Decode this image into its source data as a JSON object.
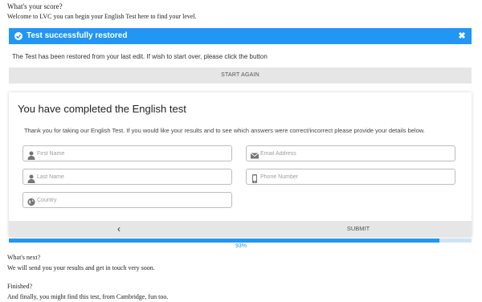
{
  "intro": {
    "question": "What's your score?",
    "text": "Welcome to LVC you can begin your English Test here to find your level."
  },
  "alert": {
    "title": "Test successfully restored",
    "close": "✖",
    "icon": "check-circle-icon",
    "color": "#2196f3",
    "message": "The Test has been restored from your last edit. If wish to start over, please click the button"
  },
  "start_again_label": "START AGAIN",
  "card": {
    "title": "You have completed the English test",
    "description": "Thank you for taking our English Test. If you would like your results and to see which answers were correct/incorrect please provide your details below.",
    "fields": {
      "first_name": {
        "placeholder": "First Name",
        "icon": "user-icon"
      },
      "email": {
        "placeholder": "Email Address",
        "icon": "envelope-icon"
      },
      "last_name": {
        "placeholder": "Last Name",
        "icon": "user-icon"
      },
      "phone": {
        "placeholder": "Phone Number",
        "icon": "mobile-phone-icon"
      },
      "country": {
        "placeholder": "Country",
        "icon": "globe-icon"
      }
    }
  },
  "nav": {
    "prev": "‹",
    "submit": "SUBMIT"
  },
  "progress": {
    "value": 0.93,
    "label": "93%"
  },
  "footer": {
    "whats_next": "What's next?",
    "next_text": "We will send you your results and get in touch very soon.",
    "finished": "Finished?",
    "finally_text": "And finally, you might find this test, from Cambridge, fun too."
  }
}
